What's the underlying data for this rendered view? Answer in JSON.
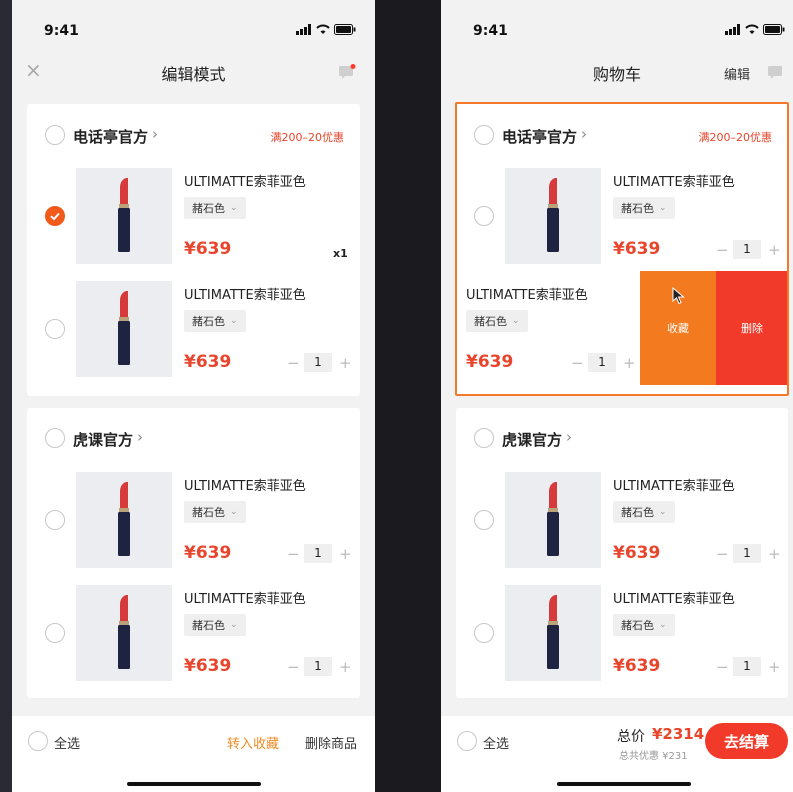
{
  "left": {
    "status": {
      "time": "9:41"
    },
    "nav": {
      "title": "编辑模式"
    },
    "stores": [
      {
        "name": "电话亭官方",
        "promo": "满200–20优惠",
        "items": [
          {
            "title": "ULTIMATTE索菲亚色",
            "variant": "赭石色",
            "price": "¥639",
            "count_badge": "x1",
            "checked": true
          },
          {
            "title": "ULTIMATTE索菲亚色",
            "variant": "赭石色",
            "price": "¥639",
            "qty": "1",
            "checked": false
          }
        ]
      },
      {
        "name": "虎课官方",
        "items": [
          {
            "title": "ULTIMATTE索菲亚色",
            "variant": "赭石色",
            "price": "¥639",
            "qty": "1",
            "checked": false
          },
          {
            "title": "ULTIMATTE索菲亚色",
            "variant": "赭石色",
            "price": "¥639",
            "qty": "1",
            "checked": false
          }
        ]
      }
    ],
    "bottom": {
      "select_all": "全选",
      "move_to_fav": "转入收藏",
      "delete_items": "删除商品"
    }
  },
  "right": {
    "status": {
      "time": "9:41"
    },
    "nav": {
      "title": "购物车",
      "edit": "编辑"
    },
    "stores": [
      {
        "name": "电话亭官方",
        "promo": "满200–20优惠",
        "items": [
          {
            "title": "ULTIMATTE索菲亚色",
            "variant": "赭石色",
            "price": "¥639",
            "qty": "1",
            "checked": false
          },
          {
            "title": "ULTIMATTE索菲亚色",
            "variant": "赭石色",
            "price": "¥639",
            "qty": "1",
            "swiped": true,
            "actions": {
              "favorite": "收藏",
              "delete": "删除"
            }
          }
        ]
      },
      {
        "name": "虎课官方",
        "items": [
          {
            "title": "ULTIMATTE索菲亚色",
            "variant": "赭石色",
            "price": "¥639",
            "qty": "1",
            "checked": false
          },
          {
            "title": "ULTIMATTE索菲亚色",
            "variant": "赭石色",
            "price": "¥639",
            "qty": "1",
            "checked": false
          }
        ]
      }
    ],
    "bottom": {
      "select_all": "全选",
      "total_label": "总价",
      "total_value": "¥2314",
      "discount": "总共优惠 ¥231",
      "checkout": "去结算"
    }
  },
  "colors": {
    "accent": "#e8452c",
    "check": "#f25a1c",
    "favorite_bg": "#f47a20",
    "delete_bg": "#f23a2a",
    "checkout_bg": "#f23a2a"
  }
}
